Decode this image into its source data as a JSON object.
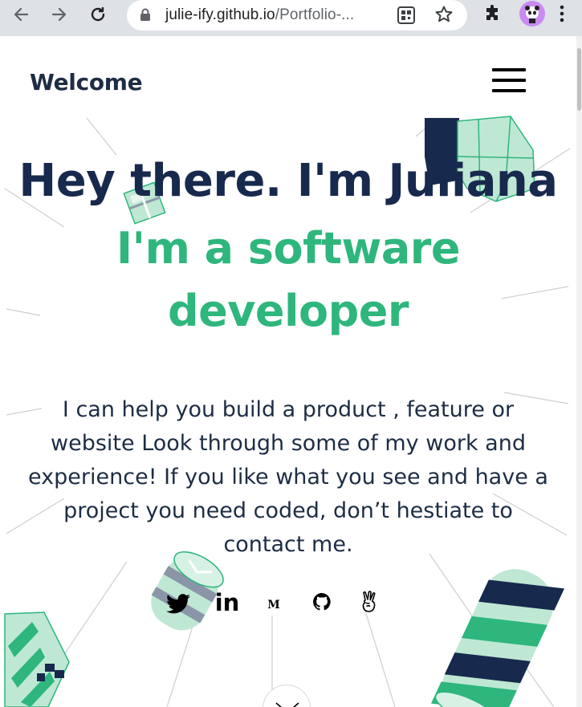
{
  "browser": {
    "url_host": "julie-ify.github.io",
    "url_path": "/Portfolio-...",
    "icons": [
      "back-arrow-icon",
      "forward-arrow-icon",
      "reload-icon",
      "lock-icon",
      "qr-code-icon",
      "bookmark-star-icon",
      "extensions-puzzle-icon",
      "profile-avatar",
      "menu-dots-icon"
    ]
  },
  "header": {
    "title": "Welcome",
    "menu_icon": "hamburger-menu-icon"
  },
  "hero": {
    "greeting": "Hey there. I'm Juliana",
    "role_line1": "I'm a software",
    "role_line2": "developer",
    "description": "I can help you build a product , feature or website Look through some of my work and experience! If you like what you see and have a project you need coded, don’t hestiate to contact me."
  },
  "socials": {
    "linkedin_label": "in",
    "medium_label": "M",
    "icons": [
      "twitter-icon",
      "linkedin-icon",
      "medium-icon",
      "github-icon",
      "angellist-icon"
    ]
  },
  "colors": {
    "navy": "#17294d",
    "green": "#2eb67d",
    "mint": "#bfe8d4",
    "chrome": "#dee1e6"
  }
}
